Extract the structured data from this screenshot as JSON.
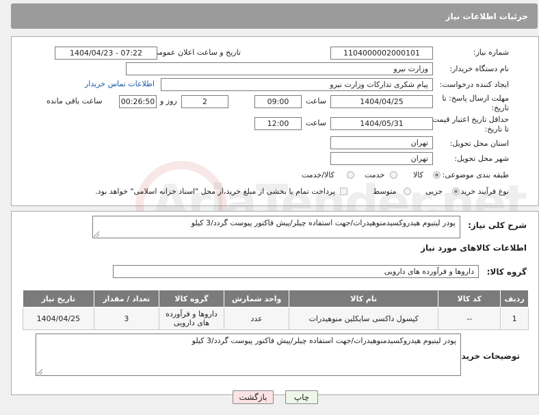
{
  "header": {
    "title": "جزئیات اطلاعات نیاز"
  },
  "form": {
    "need_number": {
      "label": "شماره نیاز:",
      "value": "1104000002000101"
    },
    "announce_datetime": {
      "label": "تاریخ و ساعت اعلان عمومی:",
      "value": "1404/04/23 - 07:22"
    },
    "buyer_org": {
      "label": "نام دستگاه خریدار:",
      "value": "وزارت نیرو"
    },
    "requester": {
      "label": "ایجاد کننده درخواست:",
      "value": "پیام شکری تدارکات وزارت نیرو",
      "contact_link": "اطلاعات تماس خریدار"
    },
    "reply_deadline": {
      "label_line1": "مهلت ارسال پاسخ: تا",
      "label_line2": "تاریخ:",
      "date": "1404/04/25",
      "time_label": "ساعت",
      "time": "09:00",
      "days": "2",
      "days_label": "روز و",
      "remaining": "00:26:50",
      "remaining_label": "ساعت باقی مانده"
    },
    "price_validity": {
      "label_line1": "حداقل تاریخ اعتبار قیمت:",
      "label_line2": "تا تاریخ:",
      "date": "1404/05/31",
      "time_label": "ساعت",
      "time": "12:00"
    },
    "delivery_province": {
      "label": "استان محل تحویل:",
      "value": "تهران"
    },
    "delivery_city": {
      "label": "شهر محل تحویل:",
      "value": "تهران"
    },
    "category": {
      "label": "طبقه بندی موضوعی:",
      "options": [
        "کالا",
        "خدمت",
        "کالا/خدمت"
      ],
      "selected": "کالا"
    },
    "purchase_process": {
      "label": "نوع فرآیند خرید :",
      "options": [
        "جزیی",
        "متوسط"
      ],
      "selected": "جزیی",
      "payment_note": "پرداخت تمام یا بخشی از مبلغ خرید،از محل \"اسناد خزانه اسلامی\" خواهد بود."
    }
  },
  "description": {
    "label": "شرح کلی نیاز:",
    "value": "پودر لیتیوم هیدروکسیدمنوهیدرات/جهت استفاده چیلر/پیش فاکتور پیوست گردد/3 کیلو"
  },
  "goods_section": {
    "title": "اطلاعات کالاهای مورد نیاز",
    "group_label": "گروه کالا:",
    "group_value": "داروها و فرآورده های دارویی"
  },
  "table": {
    "headers": [
      "ردیف",
      "کد کالا",
      "نام کالا",
      "واحد شمارش",
      "گروه کالا",
      "تعداد / مقدار",
      "تاریخ نیاز"
    ],
    "rows": [
      [
        "1",
        "--",
        "کپسول داکسی سایکلین منوهیدرات",
        "عدد",
        "داروها و فرآورده های دارویی",
        "3",
        "1404/04/25"
      ]
    ]
  },
  "buyer_notes": {
    "label": "توضیحات خریدار:",
    "value": "پودر لیتیوم هیدروکسیدمنوهیدرات/جهت استفاده چیلر/پیش فاکتور پیوست گردد/3 کیلو"
  },
  "buttons": {
    "print": "چاپ",
    "back": "بازگشت"
  },
  "watermark": "AriaTender.net"
}
